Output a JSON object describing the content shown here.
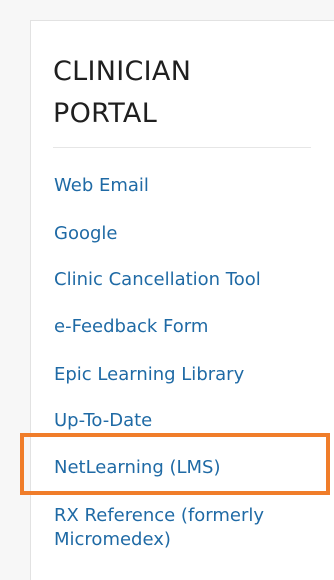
{
  "portal": {
    "title_line1": "CLINICIAN",
    "title_line2": "PORTAL",
    "links": [
      {
        "label": "Web Email"
      },
      {
        "label": "Google"
      },
      {
        "label": "Clinic Cancellation Tool"
      },
      {
        "label": "e-Feedback Form"
      },
      {
        "label": "Epic Learning Library"
      },
      {
        "label": "Up-To-Date"
      },
      {
        "label": "NetLearning (LMS)"
      },
      {
        "label": "RX Reference (formerly Micromedex)"
      }
    ]
  },
  "colors": {
    "link": "#1f6aa5",
    "highlight": "#f07d2a",
    "title": "#1f1f1f"
  }
}
